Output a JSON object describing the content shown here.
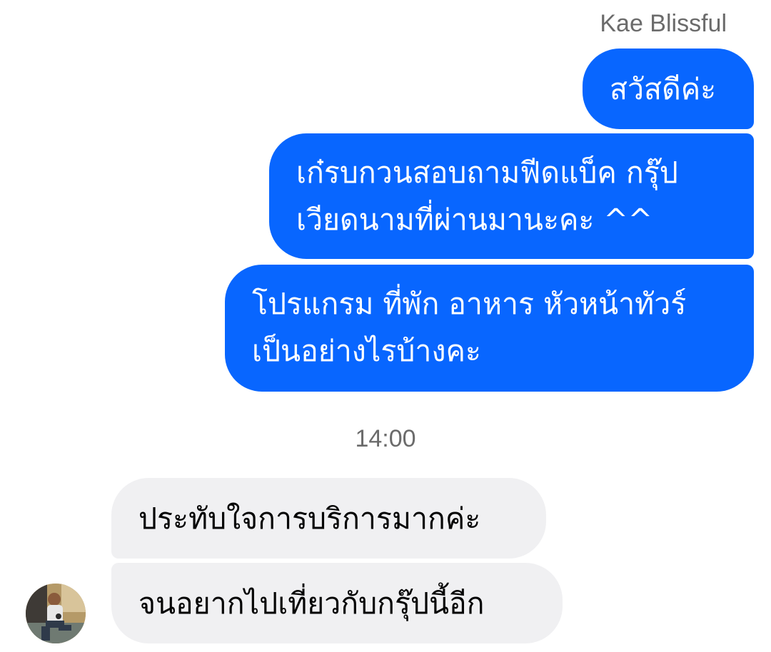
{
  "chat": {
    "sender_name": "Kae Blissful",
    "timestamp": "14:00",
    "outgoing": [
      "สวัสดีค่ะ",
      "เก๋รบกวนสอบถามฟีดแบ็ค กรุ๊ป\nเวียดนามที่ผ่านมานะคะ ^^",
      "โปรแกรม ที่พัก อาหาร หัวหน้าทัวร์\nเป็นอย่างไรบ้างคะ"
    ],
    "incoming": [
      "ประทับใจการบริการมากค่ะ",
      "จนอยากไปเที่ยวกับกรุ๊ปนี้อีก"
    ],
    "contact_avatar": "contact-avatar-photo"
  },
  "colors": {
    "outgoing_bubble": "#0866ff",
    "incoming_bubble": "#f0f0f2",
    "meta_text": "#6b6b6b"
  }
}
